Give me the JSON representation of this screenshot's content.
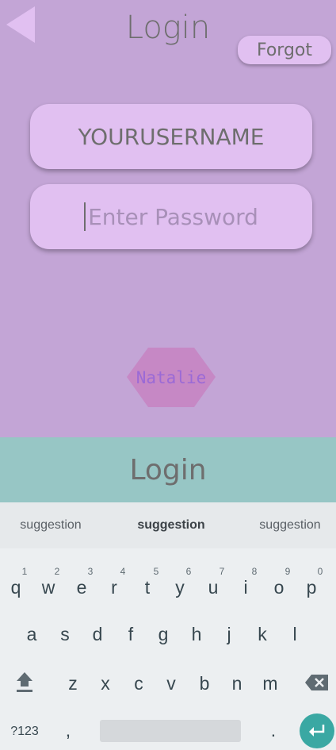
{
  "screen": {
    "title": "Login",
    "forgot_label": "Forgot",
    "username_value": "YOURUSERNAME",
    "password_placeholder": "Enter Password",
    "user_badge": "Natalie",
    "login_button": "Login"
  },
  "keyboard": {
    "suggestions": [
      "suggestion",
      "suggestion",
      "suggestion"
    ],
    "row1": [
      "q",
      "w",
      "e",
      "r",
      "t",
      "y",
      "u",
      "i",
      "o",
      "p"
    ],
    "row1_numbers": [
      "1",
      "2",
      "3",
      "4",
      "5",
      "6",
      "7",
      "8",
      "9",
      "0"
    ],
    "row2": [
      "a",
      "s",
      "d",
      "f",
      "g",
      "h",
      "j",
      "k",
      "l"
    ],
    "row3": [
      "z",
      "x",
      "c",
      "v",
      "b",
      "n",
      "m"
    ],
    "symbols_label": "?123",
    "comma": ",",
    "period": "."
  },
  "colors": {
    "background": "#c3a5d6",
    "field": "#e1c0f1",
    "login_bar": "#97c6c5",
    "badge": "#c77fbf",
    "enter_key": "#3aa8a3"
  }
}
